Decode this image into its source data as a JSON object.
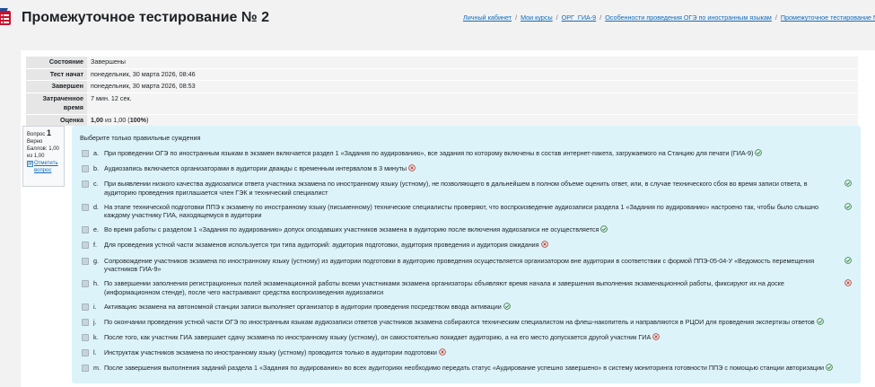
{
  "header": {
    "title": "Промежуточное тестирование № 2",
    "breadcrumb": [
      "Личный кабинет",
      "Мои курсы",
      "ОРГ_ГИА-9",
      "Особенности проведения ОГЭ по иностранным языкам",
      "Промежуточное тестирование №"
    ]
  },
  "summary": {
    "rows": [
      {
        "label": "Состояние",
        "value": "Завершены"
      },
      {
        "label": "Тест начат",
        "value": "понедельник, 30 марта 2026, 08:46"
      },
      {
        "label": "Завершен",
        "value": "понедельник, 30 марта 2026, 08:53"
      },
      {
        "label": "Затраченное время",
        "value": "7 мин. 12 сек."
      }
    ],
    "grade_label": "Оценка",
    "grade_score": "1,00",
    "grade_of": "из 1,00 (",
    "grade_percent": "100%",
    "grade_close": ")"
  },
  "question": {
    "label": "Вопрос",
    "number": "1",
    "status": "Верно",
    "points": "Баллов: 1,00 из 1,00",
    "flag_label": "Отметить вопрос",
    "prompt": "Выберите только правильные суждения"
  },
  "answers": [
    {
      "letter": "a.",
      "text": "При проведении ОГЭ по иностранным языкам в экзамен включается раздел 1 «Задания по аудированию», все задания по которому включены в состав интернет-пакета, загружаемого на Станцию для печати (ГИА-9)",
      "mark": "correct",
      "mark_pos": "inline"
    },
    {
      "letter": "b.",
      "text": "Аудиозапись включается организаторами в аудитории дважды с временным интервалом в 3 минуты",
      "mark": "incorrect",
      "mark_pos": "inline"
    },
    {
      "letter": "c.",
      "text": "При выявлении низкого качества аудиозаписи ответа участника экзамена по иностранному языку (устному), не позволяющего в дальнейшем в полном объеме оценить ответ, или, в случае технического сбоя во время записи ответа, в аудиторию проведения приглашается член ГЭК и технический специалист",
      "mark": "correct",
      "mark_pos": "right"
    },
    {
      "letter": "d.",
      "text": "На этапе технической подготовки ППЭ к экзамену по иностранному языку (письменному) технические специалисты проверяют, что воспроизведение аудиозаписи раздела 1 «Задания по аудированию» настроено так, чтобы было слышно каждому участнику ГИА, находящемуся в аудитории",
      "mark": "correct",
      "mark_pos": "right"
    },
    {
      "letter": "e.",
      "text": "Во время работы с разделом 1 «Задания по аудированию» допуск опоздавших участников экзамена в аудиторию после включения аудиозаписи не осуществляется",
      "mark": "correct",
      "mark_pos": "inline"
    },
    {
      "letter": "f.",
      "text": "Для проведения устной части экзаменов используется три типа аудиторий: аудитория подготовки, аудитория проведения и аудитория ожидания",
      "mark": "incorrect",
      "mark_pos": "inline"
    },
    {
      "letter": "g.",
      "text": "Сопровождение участников экзамена по иностранному языку (устному) из аудитории подготовки в аудиторию проведения осуществляется организатором вне аудитории в соответствии с формой ППЭ-05-04-У «Ведомость перемещения участников ГИА-9»",
      "mark": "correct",
      "mark_pos": "right"
    },
    {
      "letter": "h.",
      "text": "По завершении заполнения регистрационных полей экзаменационной работы всеми участниками экзамена организаторы объявляют время начала и завершения выполнения экзаменационной работы, фиксируют их на доске (информационном стенде), после чего настраивают средства воспроизведения аудиозаписи",
      "mark": "incorrect",
      "mark_pos": "right"
    },
    {
      "letter": "i.",
      "text": "Активацию экзамена на автономной станции записи выполняет организатор в аудитории проведения посредством ввода активации",
      "mark": "correct",
      "mark_pos": "inline"
    },
    {
      "letter": "j.",
      "text": "По окончании проведения устной части ОГЭ по иностранным языкам аудиозаписи ответов участников экзамена собираются техническим специалистом на флеш-накопитель и направляются в РЦОИ для проведения экспертизы ответов",
      "mark": "correct",
      "mark_pos": "inline"
    },
    {
      "letter": "k.",
      "text": "После того, как участник ГИА завершает сдачу экзамена по иностранному языку (устному), он самостоятельно покидает аудиторию, а на его место допускается другой участник ГИА",
      "mark": "incorrect",
      "mark_pos": "inline"
    },
    {
      "letter": "l.",
      "text": "Инструктаж участников экзамена по иностранному языку (устному) проводится только в аудитории подготовки",
      "mark": "incorrect",
      "mark_pos": "inline"
    },
    {
      "letter": "m.",
      "text": "После завершения выполнения заданий раздела 1 «Задания по аудированию» во всех аудиториях необходимо передать статус «Аудирование успешно завершено» в систему мониторинга готовности ППЭ с помощью станции авторизации",
      "mark": "correct",
      "mark_pos": "inline"
    }
  ],
  "colors": {
    "correct": "#357a32",
    "incorrect": "#ca3120",
    "link": "#0f6cbf",
    "answer_bg": "#dcf3fa"
  }
}
